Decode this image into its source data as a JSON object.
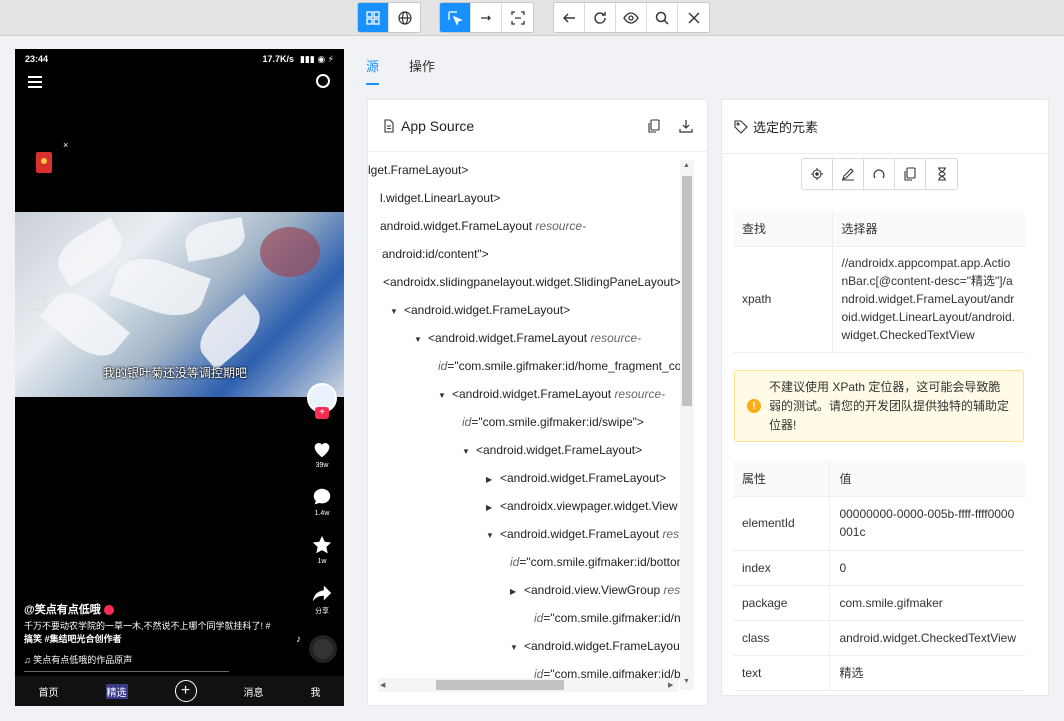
{
  "toolbar": {
    "group1": [
      "inspector-mode-icon",
      "web-globe-icon"
    ],
    "group2": [
      "select-element-icon",
      "swipe-icon",
      "tap-coordinates-icon"
    ],
    "group3": [
      "back-icon",
      "refresh-icon",
      "eye-icon",
      "search-icon",
      "close-icon"
    ]
  },
  "phone": {
    "time": "23:44",
    "network": "17.7K/s",
    "subtitle": "我的银叶菊还没等调控期吧",
    "likes": "39w",
    "comments": "1.4w",
    "favorites": "1w",
    "share": "分享",
    "author": "@笑点有点低哦",
    "desc_line1": "千万不要动农学院的一草一木,不然说不上哪个同学就挂科了! #",
    "desc_line2": "搞笑 #集结吧光合创作者",
    "music": "笑点有点低哦的作品原声",
    "nav": [
      "首页",
      "精选",
      "+",
      "消息",
      "我"
    ]
  },
  "tabs": [
    "源",
    "操作"
  ],
  "source": {
    "title": "App Source",
    "tree": [
      {
        "indent": 0,
        "caret": "",
        "text": "lget.FrameLayout>",
        "attr": "",
        "val": ""
      },
      {
        "indent": 0,
        "caret": "",
        "text": "l.widget.LinearLayout>",
        "attr": "",
        "val": ""
      },
      {
        "indent": 0,
        "caret": "",
        "text": "android.widget.FrameLayout ",
        "attr": "resource-",
        "val": ""
      },
      {
        "indent": 0,
        "caret": "",
        "text": "",
        "attr": "",
        "val": "android:id/content\">"
      },
      {
        "indent": 0,
        "caret": "",
        "text": "<androidx.slidingpanelayout.widget.SlidingPaneLayout>",
        "attr": "",
        "val": ""
      },
      {
        "indent": 1,
        "caret": "▼",
        "text": "<android.widget.FrameLayout>",
        "attr": "",
        "val": ""
      },
      {
        "indent": 2,
        "caret": "▼",
        "text": "<android.widget.FrameLayout ",
        "attr": "resource-",
        "val": ""
      },
      {
        "indent": 2,
        "caret": "",
        "text": "",
        "attr": "id",
        "val": "=\"com.smile.gifmaker:id/home_fragment_con"
      },
      {
        "indent": 3,
        "caret": "▼",
        "text": "<android.widget.FrameLayout ",
        "attr": "resource-",
        "val": ""
      },
      {
        "indent": 3,
        "caret": "",
        "text": "",
        "attr": "id",
        "val": "=\"com.smile.gifmaker:id/swipe\">"
      },
      {
        "indent": 4,
        "caret": "▼",
        "text": "<android.widget.FrameLayout>",
        "attr": "",
        "val": ""
      },
      {
        "indent": 5,
        "caret": "▶",
        "text": "<android.widget.FrameLayout>",
        "attr": "",
        "val": ""
      },
      {
        "indent": 5,
        "caret": "▶",
        "text": "<androidx.viewpager.widget.View",
        "attr": "",
        "val": ""
      },
      {
        "indent": 5,
        "caret": "▼",
        "text": "<android.widget.FrameLayout ",
        "attr": "res",
        "val": ""
      },
      {
        "indent": 5,
        "caret": "",
        "text": "",
        "attr": "id",
        "val": "=\"com.smile.gifmaker:id/bottom"
      },
      {
        "indent": 6,
        "caret": "▶",
        "text": "<android.view.ViewGroup ",
        "attr": "res",
        "val": ""
      },
      {
        "indent": 6,
        "caret": "",
        "text": "",
        "attr": "id",
        "val": "=\"com.smile.gifmaker:id/na"
      },
      {
        "indent": 6,
        "caret": "▼",
        "text": "<android.widget.FrameLayou",
        "attr": "",
        "val": ""
      },
      {
        "indent": 6,
        "caret": "",
        "text": "",
        "attr": "id",
        "val": "=\"com.smile.gifmaker:id/bo"
      }
    ]
  },
  "selected": {
    "title": "选定的元素",
    "find_headers": [
      "查找",
      "选择器"
    ],
    "find_rows": [
      {
        "key": "xpath",
        "value": "//androidx.appcompat.app.ActionBar.c[@content-desc=\"精选\"]/android.widget.FrameLayout/android.widget.LinearLayout/android.widget.CheckedTextView"
      }
    ],
    "warning": "不建议使用 XPath 定位器，这可能会导致脆弱的测试。请您的开发团队提供独特的辅助定位器!",
    "attr_headers": [
      "属性",
      "值"
    ],
    "attrs": [
      {
        "key": "elementId",
        "value": "00000000-0000-005b-ffff-ffff0000001c"
      },
      {
        "key": "index",
        "value": "0"
      },
      {
        "key": "package",
        "value": "com.smile.gifmaker"
      },
      {
        "key": "class",
        "value": "android.widget.CheckedTextView"
      },
      {
        "key": "text",
        "value": "精选"
      }
    ]
  },
  "colors": {
    "accent": "#1890ff",
    "warning_bg": "#fffbe6",
    "warning_border": "#ffe58f"
  }
}
